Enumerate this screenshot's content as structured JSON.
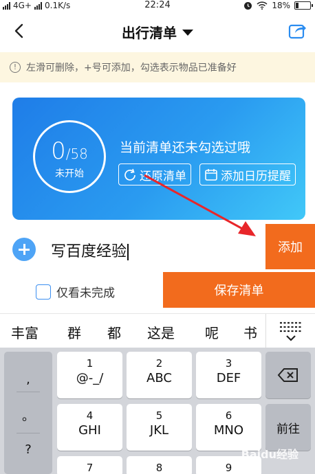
{
  "status_bar": {
    "left": "4G+",
    "speed": "0.1K/s",
    "time": "22:24",
    "battery": "18%",
    "battery_level": 0.18
  },
  "header": {
    "title": "出行清单",
    "icons": {
      "back": "back-arrow-icon",
      "dropdown": "caret-down-icon",
      "share": "share-icon"
    }
  },
  "tip": {
    "text": "左滑可删除，+号可添加，勾选表示物品已准备好",
    "icon": "info-icon"
  },
  "card": {
    "checked": "0",
    "total": "/58",
    "status": "未开始",
    "message": "当前清单还未勾选过哦",
    "restore_label": "还原清单",
    "calendar_label": "添加日历提醒",
    "colors": {
      "gradient_start": "#1f7de8",
      "gradient_end": "#41c8f8"
    }
  },
  "add_row": {
    "input_value": "写百度经验",
    "add_label": "添加",
    "accent": "#f26b1d"
  },
  "action_bar": {
    "only_unfinished_label": "仅看未完成",
    "save_label": "保存清单"
  },
  "candidates": [
    "丰富",
    "群",
    "都",
    "这是",
    "呢",
    "书"
  ],
  "keyboard": {
    "side": [
      ",",
      "。",
      "?"
    ],
    "keys": [
      {
        "d": "1",
        "l": "@-_/"
      },
      {
        "d": "2",
        "l": "ABC"
      },
      {
        "d": "3",
        "l": "DEF"
      },
      {
        "d": "4",
        "l": "GHI"
      },
      {
        "d": "5",
        "l": "JKL"
      },
      {
        "d": "6",
        "l": "MNO"
      },
      {
        "d": "7",
        "l": ""
      },
      {
        "d": "8",
        "l": ""
      },
      {
        "d": "9",
        "l": ""
      }
    ],
    "go_label": "前往",
    "backspace_icon": "backspace-icon"
  },
  "watermark": "Baidu经验"
}
